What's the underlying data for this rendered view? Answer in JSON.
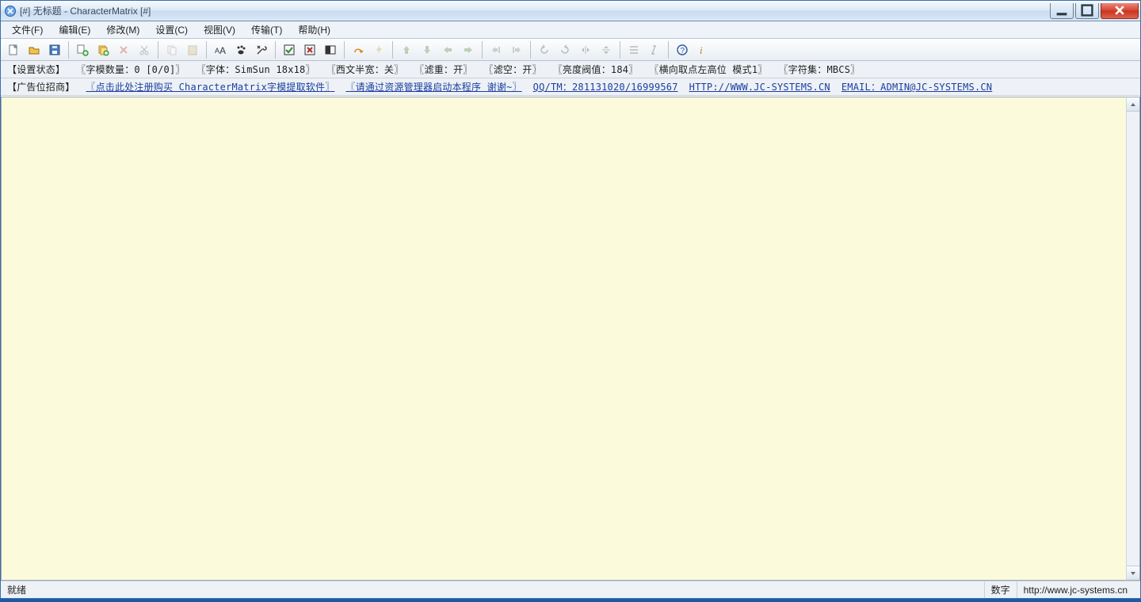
{
  "window": {
    "title": "[#] 无标题 - CharacterMatrix [#]"
  },
  "menu": {
    "file": "文件(F)",
    "edit": "编辑(E)",
    "modify": "修改(M)",
    "settings": "设置(C)",
    "view": "视图(V)",
    "transfer": "传输(T)",
    "help": "帮助(H)"
  },
  "status1": {
    "label": "【设置状态】",
    "count": "〖字模数量：0 [0/0]〗",
    "font": "〖字体：SimSun 18x18〗",
    "halfwidth": "〖西文半宽：关〗",
    "filter": "〖滤重：开〗",
    "blank": "〖滤空：开〗",
    "threshold": "〖亮度阀值：184〗",
    "mode": "〖横向取点左高位 模式1〗",
    "charset": "〖字符集：MBCS〗"
  },
  "status2": {
    "label": "【广告位招商】",
    "buy": "〖点击此处注册购买 CharacterMatrix字模提取软件〗",
    "resmgr": "〖请通过资源管理器启动本程序 谢谢~〗",
    "qq": "QQ/TM：281131020/16999567",
    "url": "HTTP://WWW.JC-SYSTEMS.CN",
    "email": "EMAIL：ADMIN@JC-SYSTEMS.CN"
  },
  "statusbar": {
    "ready": "就绪",
    "num": "数字",
    "site": "http://www.jc-systems.cn"
  }
}
